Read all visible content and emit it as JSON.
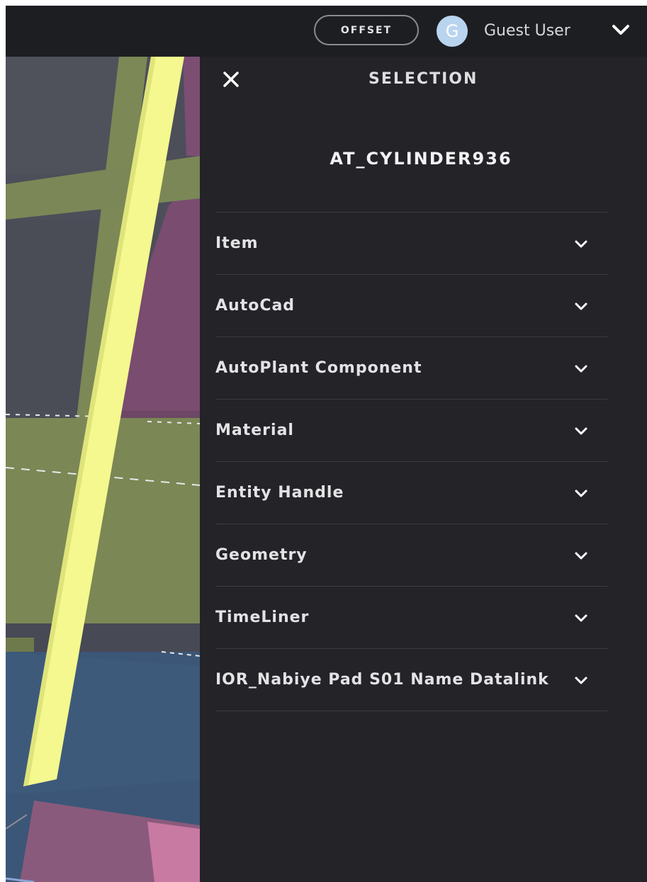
{
  "header": {
    "offset_label": "OFFSET",
    "avatar_initial": "G",
    "user_name": "Guest User"
  },
  "panel": {
    "title": "SELECTION",
    "object_name": "AT_CYLINDER936",
    "sections": [
      {
        "label": "Item"
      },
      {
        "label": "AutoCad"
      },
      {
        "label": "AutoPlant Component"
      },
      {
        "label": "Material"
      },
      {
        "label": "Entity Handle"
      },
      {
        "label": "Geometry"
      },
      {
        "label": "TimeLiner"
      },
      {
        "label": "IOR_Nabiye Pad S01 Name Datalink"
      }
    ]
  },
  "icons": {
    "close": "close-icon",
    "chevron": "chevron-down-icon"
  },
  "colors": {
    "highlight_pipe": "#f3f88d",
    "olive_beam": "#7a8654",
    "pink_surface": "#7c4e72",
    "blue_surface": "#3a5575",
    "panel_background": "#232328"
  }
}
